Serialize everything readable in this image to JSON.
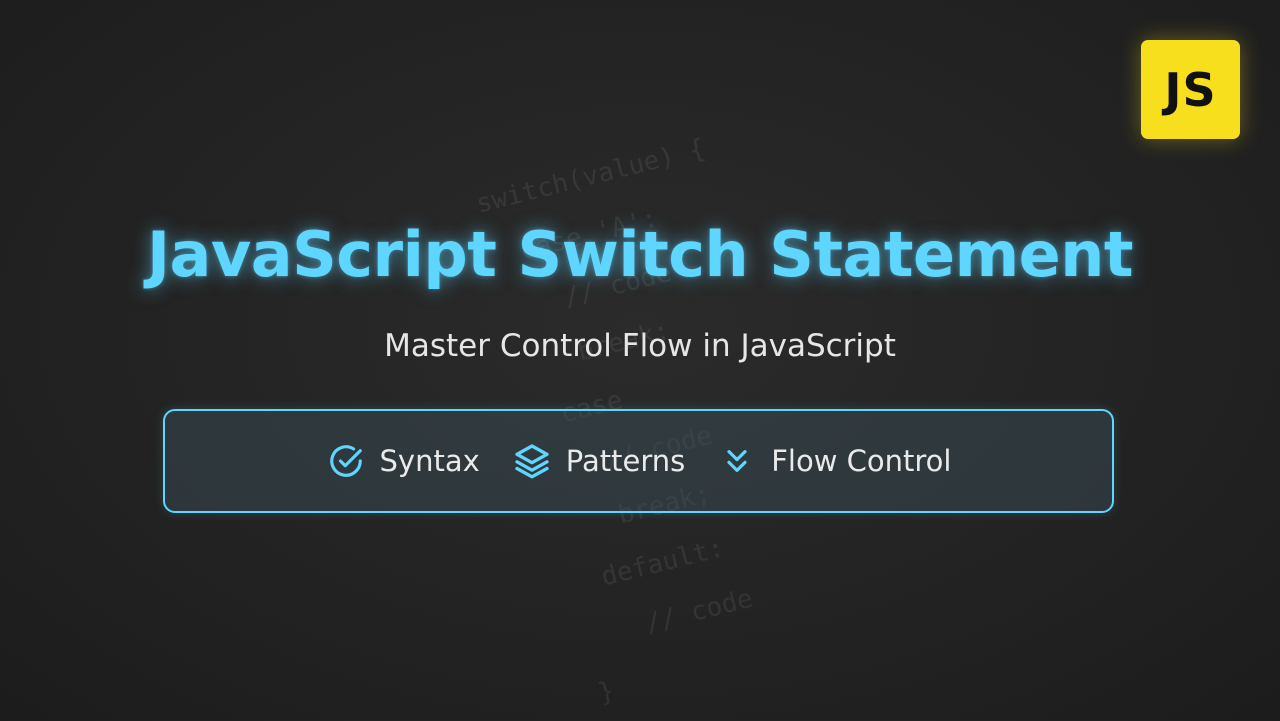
{
  "badge": {
    "label": "JS",
    "color": "#f7df1e"
  },
  "title": "JavaScript Switch Statement",
  "subtitle": "Master Control Flow in JavaScript",
  "background_code": [
    "switch(value) {",
    "  case 'A':",
    "    // code",
    "    break;",
    "  case",
    "    // code",
    "    break;",
    "  default:",
    "    // code",
    "}"
  ],
  "features": [
    {
      "label": "Syntax",
      "icon": "check-circle-icon"
    },
    {
      "label": "Patterns",
      "icon": "layers-icon"
    },
    {
      "label": "Flow Control",
      "icon": "chevrons-down-icon"
    }
  ],
  "colors": {
    "accent": "#5fd6ff",
    "background": "#232323",
    "text": "#e6e6e6"
  }
}
